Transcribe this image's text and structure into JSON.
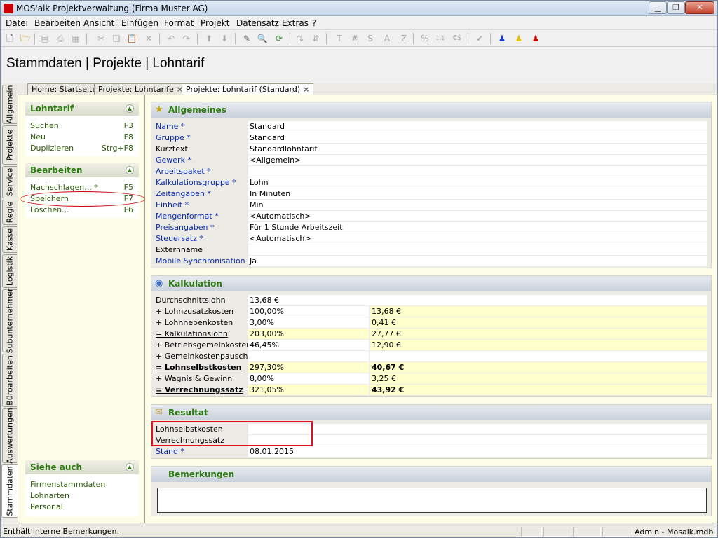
{
  "window": {
    "title": "MOS'aik Projektverwaltung (Firma Muster AG)",
    "controls": [
      "minimize",
      "maximize",
      "close"
    ]
  },
  "menu": [
    "Datei",
    "Bearbeiten",
    "Ansicht",
    "Einfügen",
    "Format",
    "Projekt",
    "Datensatz",
    "Extras",
    "?"
  ],
  "toolbar": {
    "icons": [
      "new-icon",
      "open-icon",
      "print-preview-icon",
      "print-icon",
      "print-setup-icon",
      "cut-icon",
      "copy-icon",
      "paste-icon",
      "delete-icon",
      "undo-icon",
      "redo-icon",
      "move-up-icon",
      "move-down-icon",
      "edit-icon",
      "search-icon",
      "refresh-icon",
      "sort-asc-icon",
      "sort-desc-icon",
      "text-icon",
      "number-icon",
      "sum-icon",
      "average-icon",
      "z-icon",
      "percent-icon",
      "decimals-icon",
      "currency-icon",
      "check-icon",
      "user-blue-icon",
      "user-yellow-icon",
      "user-red-icon"
    ],
    "labels": {
      "t": "T",
      "hash": "#",
      "s": "S",
      "a": "A",
      "z": "Z",
      "pct": "%",
      "dec": "1.1",
      "cur": "€$"
    }
  },
  "page_title": "Stammdaten | Projekte | Lohntarif",
  "vertical_tabs": [
    "Allgemein",
    "Projekte",
    "Service",
    "Regie",
    "Kasse",
    "Logistik",
    "Subunternehmer",
    "Büroarbeiten",
    "Auswertungen",
    "Stammdaten"
  ],
  "tabs": [
    {
      "label": "Home: Startseite",
      "closable": false
    },
    {
      "label": "Projekte: Lohntarife",
      "closable": true
    },
    {
      "label": "Projekte: Lohntarif (Standard)",
      "closable": true,
      "active": true
    }
  ],
  "tabs_close": "×",
  "taskpanes": {
    "lohntarif": {
      "title": "Lohntarif",
      "items": [
        {
          "label": "Suchen",
          "key": "F3"
        },
        {
          "label": "Neu",
          "key": "F8"
        },
        {
          "label": "Duplizieren",
          "key": "Strg+F8"
        }
      ]
    },
    "bearbeiten": {
      "title": "Bearbeiten",
      "items": [
        {
          "label": "Nachschlagen... *",
          "key": "F5"
        },
        {
          "label": "Speichern",
          "key": "F7"
        },
        {
          "label": "Löschen...",
          "key": "F6"
        }
      ]
    },
    "siehe_auch": {
      "title": "Siehe auch",
      "items": [
        {
          "label": "Firmenstammdaten"
        },
        {
          "label": "Lohnarten"
        },
        {
          "label": "Personal"
        }
      ]
    }
  },
  "chevron": "▲",
  "allgemeines": {
    "title": "Allgemeines",
    "fields": [
      {
        "label": "Name *",
        "value": "Standard",
        "link": true
      },
      {
        "label": "Gruppe *",
        "value": "Standard",
        "link": true
      },
      {
        "label": "Kurztext",
        "value": "Standardlohntarif",
        "link": false
      },
      {
        "label": "Gewerk *",
        "value": "<Allgemein>",
        "link": true
      },
      {
        "label": "Arbeitspaket *",
        "value": "",
        "link": true
      },
      {
        "label": "Kalkulationsgruppe *",
        "value": "Lohn",
        "link": true
      },
      {
        "label": "Zeitangaben *",
        "value": "In Minuten",
        "link": true
      },
      {
        "label": "Einheit *",
        "value": "Min",
        "link": true
      },
      {
        "label": "Mengenformat *",
        "value": "<Automatisch>",
        "link": true
      },
      {
        "label": "Preisangaben *",
        "value": "Für 1 Stunde Arbeitszeit",
        "link": true
      },
      {
        "label": "Steuersatz *",
        "value": "<Automatisch>",
        "link": true
      },
      {
        "label": "Externname",
        "value": "",
        "link": false
      },
      {
        "label": "Mobile Synchronisation *",
        "value": "Ja",
        "link": true
      }
    ]
  },
  "kalkulation": {
    "title": "Kalkulation",
    "rows": [
      {
        "label": "Durchschnittslohn",
        "v1": "13,68 €",
        "v2": null,
        "style": ""
      },
      {
        "label": "+ Lohnzusatzkosten",
        "v1": "100,00%",
        "v2": "13,68 €",
        "style": ""
      },
      {
        "label": "+ Lohnnebenkosten",
        "v1": "3,00%",
        "v2": "0,41 €",
        "style": ""
      },
      {
        "label": "= Kalkulationslohn",
        "v1": "203,00%",
        "v2": "27,77 €",
        "style": "sum"
      },
      {
        "label": "+ Betriebsgemeinkosten",
        "v1": "46,45%",
        "v2": "12,90 €",
        "style": ""
      },
      {
        "label": "+ Gemeinkostenpauschale",
        "v1": "",
        "v2": "",
        "style": "white"
      },
      {
        "label": "= Lohnselbstkosten",
        "v1": "297,30%",
        "v2": "40,67 €",
        "style": "boldsum"
      },
      {
        "label": "+ Wagnis & Gewinn",
        "v1": "8,00%",
        "v2": "3,25 €",
        "style": ""
      },
      {
        "label": "= Verrechnungssatz",
        "v1": "321,05%",
        "v2": "43,92 €",
        "style": "boldsum"
      }
    ]
  },
  "resultat": {
    "title": "Resultat",
    "fields": [
      {
        "label": "Lohnselbstkosten",
        "value": "",
        "link": false
      },
      {
        "label": "Verrechnungssatz",
        "value": "",
        "link": false
      },
      {
        "label": "Stand *",
        "value": "08.01.2015",
        "link": true
      }
    ]
  },
  "bemerkungen": {
    "title": "Bemerkungen",
    "value": ""
  },
  "statusbar": {
    "message": "Enthält interne Bemerkungen.",
    "user": "Admin - Mosaik.mdb"
  }
}
